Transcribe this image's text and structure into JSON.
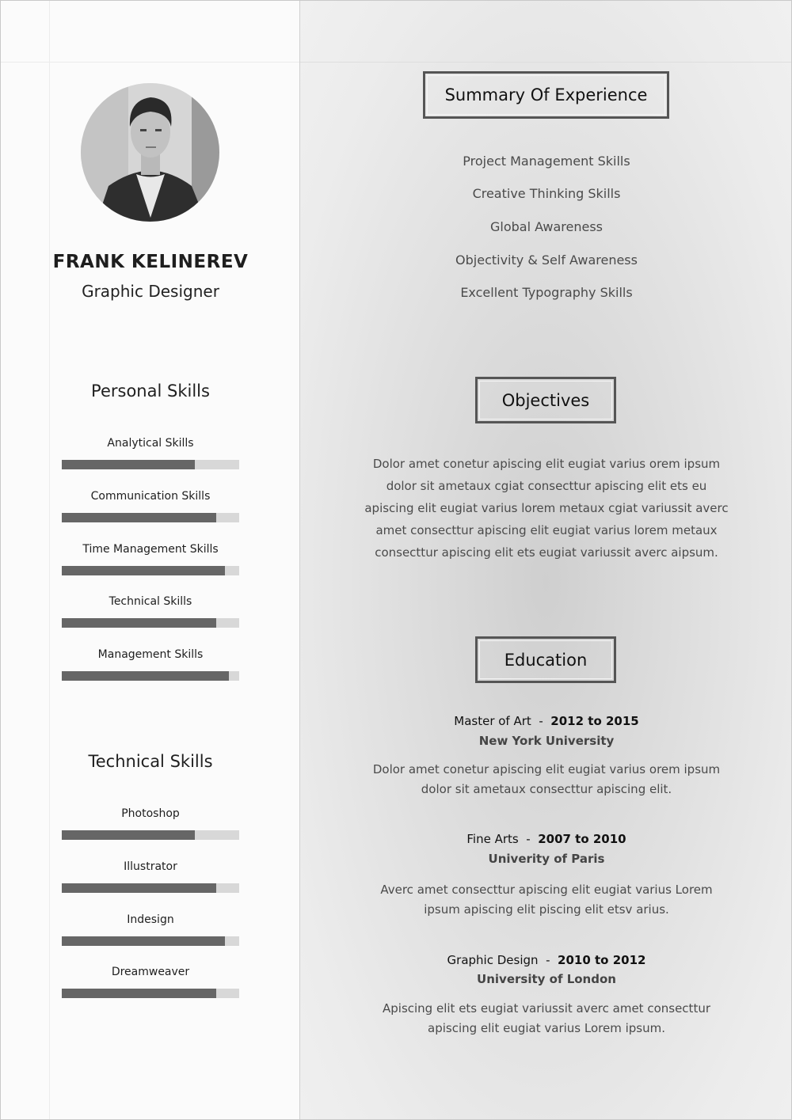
{
  "profile": {
    "name": "FRANK KELINEREV",
    "role": "Graphic Designer"
  },
  "personal_skills": {
    "title": "Personal Skills",
    "items": [
      {
        "label": "Analytical Skills",
        "level": 0.75
      },
      {
        "label": "Communication Skills",
        "level": 0.87
      },
      {
        "label": "Time Management Skills",
        "level": 0.92
      },
      {
        "label": "Technical Skills",
        "level": 0.87
      },
      {
        "label": "Management Skills",
        "level": 0.94
      }
    ]
  },
  "technical_skills": {
    "title": "Technical Skills",
    "items": [
      {
        "label": "Photoshop",
        "level": 0.75
      },
      {
        "label": "Illustrator",
        "level": 0.87
      },
      {
        "label": "Indesign",
        "level": 0.92
      },
      {
        "label": "Dreamweaver",
        "level": 0.87
      }
    ]
  },
  "summary": {
    "title": "Summary Of Experience",
    "items": [
      "Project Management Skills",
      "Creative Thinking Skills",
      "Global Awareness",
      "Objectivity & Self Awareness",
      "Excellent Typography Skills"
    ]
  },
  "objectives": {
    "title": "Objectives",
    "text": "Dolor amet conetur apiscing elit eugiat varius orem ipsum dolor sit ametaux cgiat consecttur apiscing elit ets eu apiscing elit eugiat varius lorem metaux cgiat variussit averc amet consecttur apiscing elit eugiat varius lorem metaux consecttur apiscing elit ets eugiat variussit averc aipsum."
  },
  "education": {
    "title": "Education",
    "entries": [
      {
        "degree": "Master of Art",
        "years": "2012 to 2015",
        "school": "New York University",
        "description": "Dolor amet conetur apiscing elit eugiat varius orem ipsum dolor sit ametaux consecttur apiscing elit."
      },
      {
        "degree": "Fine Arts",
        "years": "2007 to 2010",
        "school": "Univerity of Paris",
        "description": "Averc amet consecttur apiscing elit eugiat varius Lorem ipsum apiscing elit piscing elit etsv arius."
      },
      {
        "degree": "Graphic Design",
        "years": "2010 to 2012",
        "school": "University of London",
        "description": "Apiscing elit ets eugiat variussit averc amet consecttur apiscing elit eugiat varius Lorem ipsum."
      }
    ]
  }
}
